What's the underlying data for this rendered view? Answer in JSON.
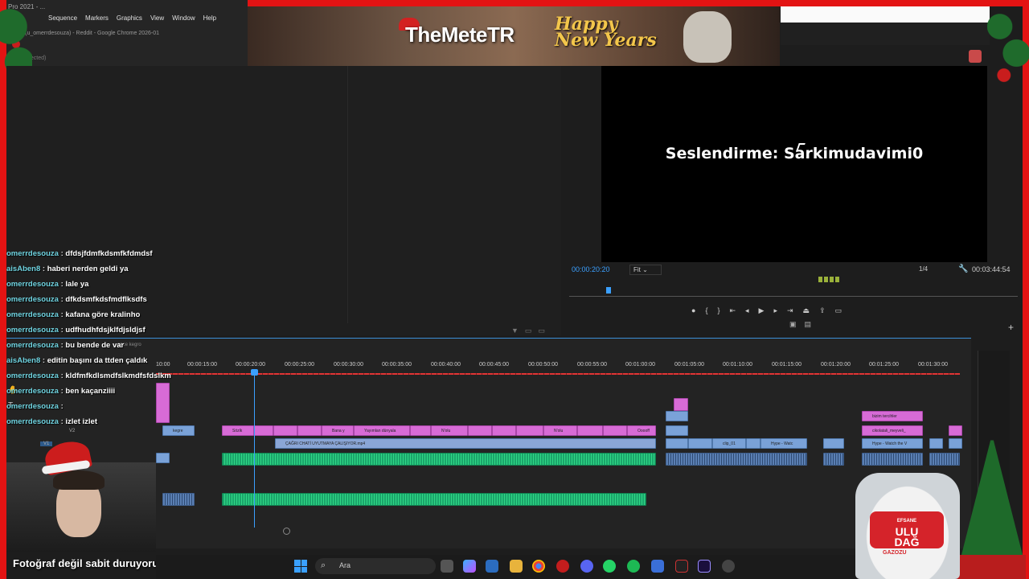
{
  "window": {
    "title_fragment": "Pro 2021 - ...",
    "menu": [
      "Sequence",
      "Markers",
      "Graphics",
      "View",
      "Window",
      "Help"
    ],
    "chrome_tab": "ouza (u_omerrdesouza) - Reddit - Google Chrome 2026-01",
    "clip_selected": "lip selected)"
  },
  "banner": {
    "channel_name": "TheMeteTR",
    "greeting_line1": "Happy",
    "greeting_line2": "New Years"
  },
  "program_monitor": {
    "caption": "Seslendirme: Sarkimudavimi0",
    "timecode_left": "00:00:20:20",
    "fit": "Fit",
    "quality": "1/4",
    "timecode_right": "00:03:44:54"
  },
  "timeline": {
    "ruler_labels": [
      "10:00",
      "00:00:15:00",
      "00:00:20:00",
      "00:00:25:00",
      "00:00:30:00",
      "00:00:35:00",
      "00:00:40:00",
      "00:00:45:00",
      "00:00:50:00",
      "00:00:55:00",
      "00:01:00:00",
      "00:01:05:00",
      "00:01:10:00",
      "00:01:15:00",
      "00:01:20:00",
      "00:01:25:00",
      "00:01:30:00"
    ],
    "track_v2": "V2",
    "track_v1": "V1",
    "clip_labels": {
      "kegre": "kegre",
      "sozlk": "Sözlk",
      "bana": "Bana y",
      "yayimlan": "Yayımlan dünyala",
      "nolu1": "N'olu",
      "nolu2": "N'olu",
      "ooooff": "Ooooff",
      "main_video": "ÇAĞRI CHATİ UYUTMAYA ÇALIŞIYOR.mp4",
      "clip01": "clip_01",
      "hype": "Hype - Watc",
      "bizim": "bizim tercihler",
      "cikolata": "cikolatali_meyveli_",
      "hype2": "Hype - Watch the V",
      "sequence_hint": "ence kegro"
    }
  },
  "chat": [
    {
      "user": "omerrdesouza",
      "msg": "dfdsjfdmfkdsmfkfdmdsf"
    },
    {
      "user": "aisAben8",
      "msg": "haberi nerden geldi ya"
    },
    {
      "user": "omerrdesouza",
      "msg": "lale ya"
    },
    {
      "user": "omerrdesouza",
      "msg": "dfkdsmfkdsfmdflksdfs"
    },
    {
      "user": "omerrdesouza",
      "msg": "kafana göre kralinho"
    },
    {
      "user": "omerrdesouza",
      "msg": "udfhudhfdsjklfdjsldjsf"
    },
    {
      "user": "omerrdesouza",
      "msg": "bu bende de var"
    },
    {
      "user": "aisAben8",
      "msg": "editin başını da ttden çaldık"
    },
    {
      "user": "omerrdesouza",
      "msg": "kldfmfkdlsmdfslkmdfsfdslkm"
    },
    {
      "user": "omerrdesouza",
      "msg": "ben kaçanziiii"
    },
    {
      "user": "omerrdesouza",
      "msg": ""
    },
    {
      "user": "omerrdesouza",
      "msg": "izlet izlet"
    }
  ],
  "webcam": {
    "caption": "Fotoğraf değil sabit duruyorum"
  },
  "taskbar": {
    "search_placeholder": "Ara"
  },
  "product": {
    "brand_line1": "ULU",
    "brand_line2": "DAĞ",
    "sub": "GAZOZU",
    "top": "EFSANE"
  },
  "colors": {
    "frame_red": "#e31313",
    "timeline_blue": "#3ba0ff",
    "clip_pink": "#d76bd6",
    "clip_blue": "#7aa2d8",
    "clip_green": "#1ba56b"
  }
}
